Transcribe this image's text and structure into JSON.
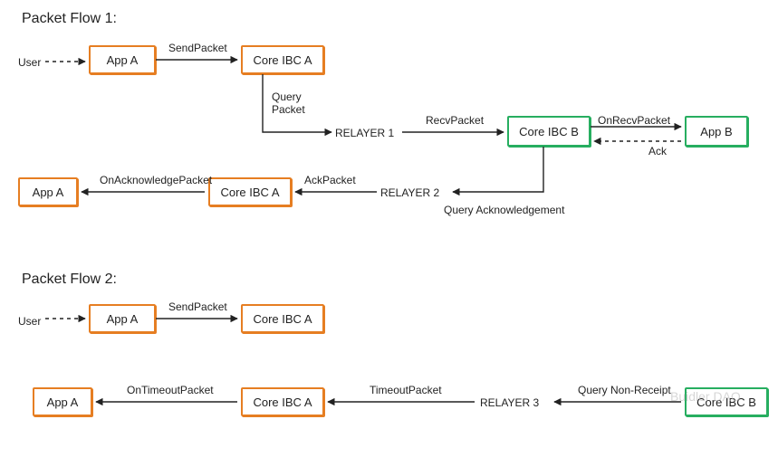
{
  "flow1": {
    "title": "Packet Flow 1:",
    "user": "User",
    "appA1": "App A",
    "coreA1": "Core IBC A",
    "relayer1": "RELAYER 1",
    "coreB": "Core IBC B",
    "appB": "App B",
    "relayer2": "RELAYER 2",
    "coreA2": "Core IBC A",
    "appA2": "App A",
    "labels": {
      "sendPacket": "SendPacket",
      "queryPacket": "Query",
      "queryPacket2": "Packet",
      "recvPacket": "RecvPacket",
      "onRecvPacket": "OnRecvPacket",
      "ack": "Ack",
      "queryAck": "Query Acknowledgement",
      "ackPacket": "AckPacket",
      "onAckPacket": "OnAcknowledgePacket"
    }
  },
  "flow2": {
    "title": "Packet Flow 2:",
    "user": "User",
    "appA1": "App A",
    "coreA1": "Core IBC A",
    "coreB": "Core IBC B",
    "relayer3": "RELAYER 3",
    "coreA2": "Core IBC A",
    "appA2": "App A",
    "labels": {
      "sendPacket": "SendPacket",
      "queryNonReceipt": "Query Non-Receipt",
      "timeoutPacket": "TimeoutPacket",
      "onTimeoutPacket": "OnTimeoutPacket"
    }
  },
  "watermark": "Buidler DAO"
}
